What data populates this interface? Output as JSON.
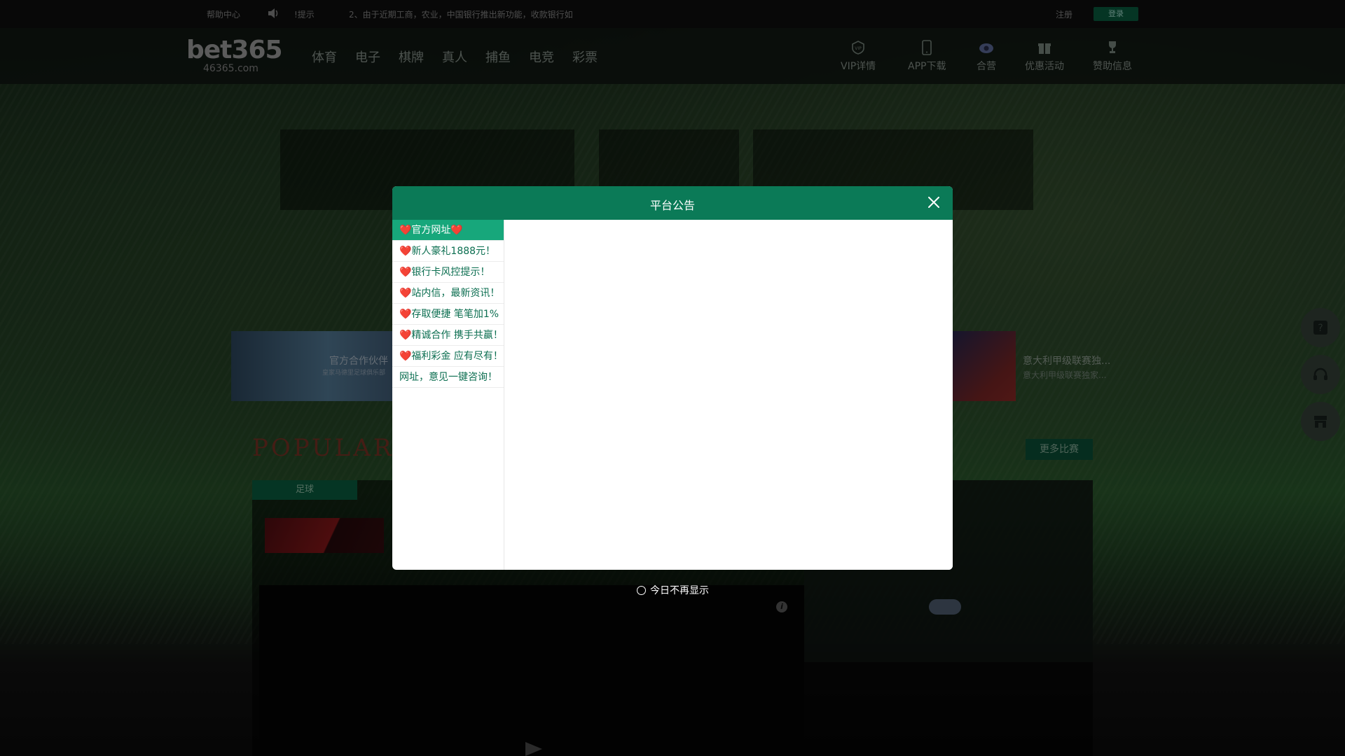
{
  "topbar": {
    "help": "帮助中心",
    "notice_label": "!提示",
    "notice_text": "2、由于近期工商，农业，中国银行推出新功能，收款银行如",
    "register": "注册",
    "login": "登录"
  },
  "logo": {
    "brand": "bet365",
    "domain": "46365.com"
  },
  "nav": {
    "main": [
      "体育",
      "电子",
      "棋牌",
      "真人",
      "捕鱼",
      "电竞",
      "彩票"
    ],
    "right": [
      {
        "label": "VIP详情",
        "icon": "vip-icon"
      },
      {
        "label": "APP下载",
        "icon": "phone-icon"
      },
      {
        "label": "合营",
        "icon": "eye-icon"
      },
      {
        "label": "优惠活动",
        "icon": "gift-icon"
      },
      {
        "label": "赞助信息",
        "icon": "trophy-icon"
      }
    ]
  },
  "promo": {
    "left_title": "官方合作伙伴",
    "left_sub": "皇家马德里足球俱乐部",
    "right_title": "意大利甲级联赛独...",
    "right_sub": "意大利甲级联赛独家..."
  },
  "popular": {
    "title": "POPULAR",
    "more": "更多比赛",
    "tab": "足球"
  },
  "side_float": [
    "help-icon",
    "headset-icon",
    "shop-icon"
  ],
  "modal": {
    "title": "平台公告",
    "items": [
      "❤️官方网址❤️",
      "❤️新人豪礼1888元！",
      "❤️银行卡风控提示！",
      "❤️站内信，最新资讯！",
      "❤️存取便捷 笔笔加1%",
      "❤️精诚合作 携手共赢！",
      "❤️福利彩金 应有尽有！",
      "网址，意见一键咨询！"
    ],
    "active_index": 0,
    "dont_show": "今日不再显示"
  },
  "colors": {
    "accent": "#0b7a57",
    "active_item": "#17a77b",
    "item_text": "#0b6e50"
  }
}
